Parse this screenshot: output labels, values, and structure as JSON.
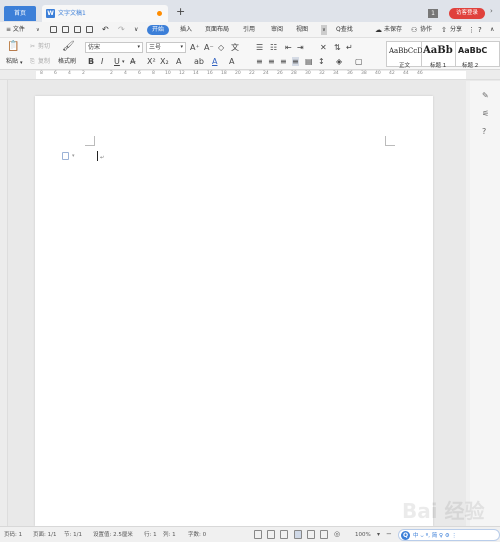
{
  "titlebar": {
    "home_tab": "首页",
    "doc_tab": "文字文稿1",
    "doc_icon": "W",
    "add_tab": "+",
    "badge": "1",
    "login": "访客登录",
    "more": "›"
  },
  "menubar": {
    "file": "≡ 文件",
    "file_arrow": "∨",
    "items": [
      "开始",
      "插入",
      "页面布局",
      "引用",
      "审阅",
      "视图"
    ],
    "search": "Q查找",
    "unsaved": "未保存",
    "collab": "协作",
    "share": "分享"
  },
  "ribbon": {
    "cut": "剪切",
    "copy": "复制",
    "paste": "粘贴",
    "format_painter": "格式刷",
    "font_name": "仿宋",
    "font_size": "三号",
    "styles": [
      {
        "sample": "AaBbCcDd",
        "name": "正文"
      },
      {
        "sample": "AaBb",
        "name": "标题 1"
      },
      {
        "sample": "AaBbC",
        "name": "标题 2"
      }
    ]
  },
  "ruler": {
    "marks": [
      "8",
      "6",
      "4",
      "2",
      "",
      "2",
      "4",
      "6",
      "8",
      "10",
      "12",
      "14",
      "16",
      "18",
      "20",
      "22",
      "24",
      "26",
      "28",
      "30",
      "32",
      "34",
      "36",
      "38",
      "40",
      "42",
      "44",
      "46"
    ]
  },
  "document": {
    "paragraph_mark": "↵"
  },
  "statusbar": {
    "page": "页码: 1",
    "pages": "页面: 1/1",
    "section": "节: 1/1",
    "setting": "设置值: 2.5厘米",
    "row": "行: 1",
    "col": "列: 1",
    "words": "字数: 0",
    "zoom": "100%",
    "zoom_minus": "−"
  },
  "ime": {
    "q": "Q",
    "text": "中 ⌣ º, 简 ♀ ⚙ ⋮"
  },
  "watermark": "Bai 经验"
}
